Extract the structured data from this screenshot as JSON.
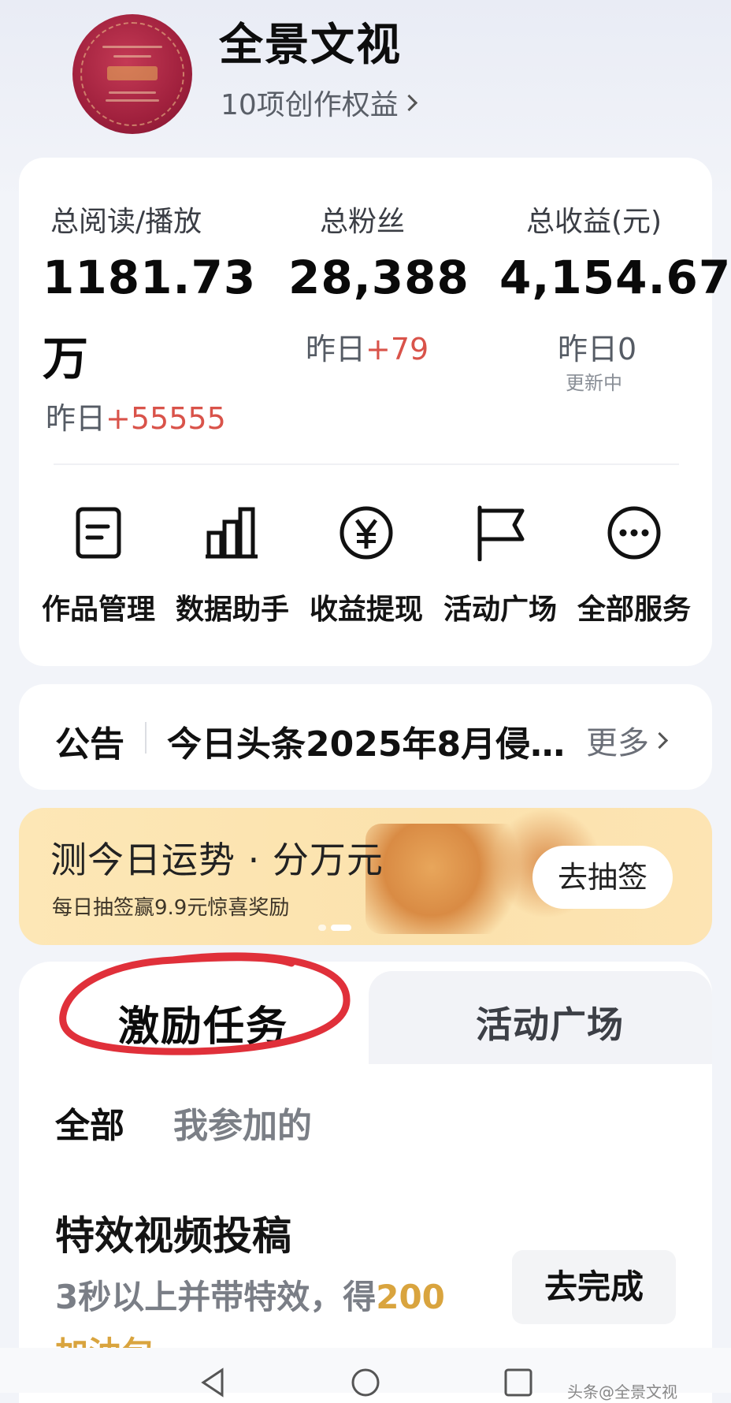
{
  "header": {
    "account_name": "全景文视",
    "benefits_label": "10项创作权益",
    "avatar_text": "荣誉证书"
  },
  "stats": [
    {
      "label": "总阅读/播放",
      "value_line1": "1181.73",
      "value_line2": "万",
      "sub_prefix": "昨日",
      "sub_value": "+55555"
    },
    {
      "label": "总粉丝",
      "value_line1": "28,388",
      "sub_prefix": "昨日",
      "sub_value": "+79"
    },
    {
      "label": "总收益(元)",
      "value_line1": "4,154.67",
      "sub_prefix": "昨日",
      "sub_value": "0",
      "note": "更新中"
    }
  ],
  "services": [
    {
      "label": "作品管理",
      "icon": "document-icon"
    },
    {
      "label": "数据助手",
      "icon": "bar-chart-icon"
    },
    {
      "label": "收益提现",
      "icon": "yen-coin-icon"
    },
    {
      "label": "活动广场",
      "icon": "flag-icon"
    },
    {
      "label": "全部服务",
      "icon": "more-icon"
    }
  ],
  "notice": {
    "tag": "公告",
    "text": "今日头条2025年8月侵…",
    "more_label": "更多"
  },
  "banner": {
    "title": "测今日运势 · 分万元",
    "desc": "每日抽签赢9.9元惊喜奖励",
    "button": "去抽签"
  },
  "tabs": {
    "active": "激励任务",
    "inactive": "活动广场",
    "annotation_color": "#e0303a"
  },
  "filters": {
    "all": "全部",
    "mine": "我参加的"
  },
  "task": {
    "title": "特效视频投稿",
    "desc_prefix": "3秒以上并带特效，得",
    "reward_amount": "200",
    "reward_unit": "加油包",
    "button": "去完成"
  },
  "watermark": "头条@全景文视",
  "colors": {
    "accent_red": "#d9534a",
    "reward_gold": "#d9a43e",
    "banner_bg": "#fbe2ad"
  }
}
